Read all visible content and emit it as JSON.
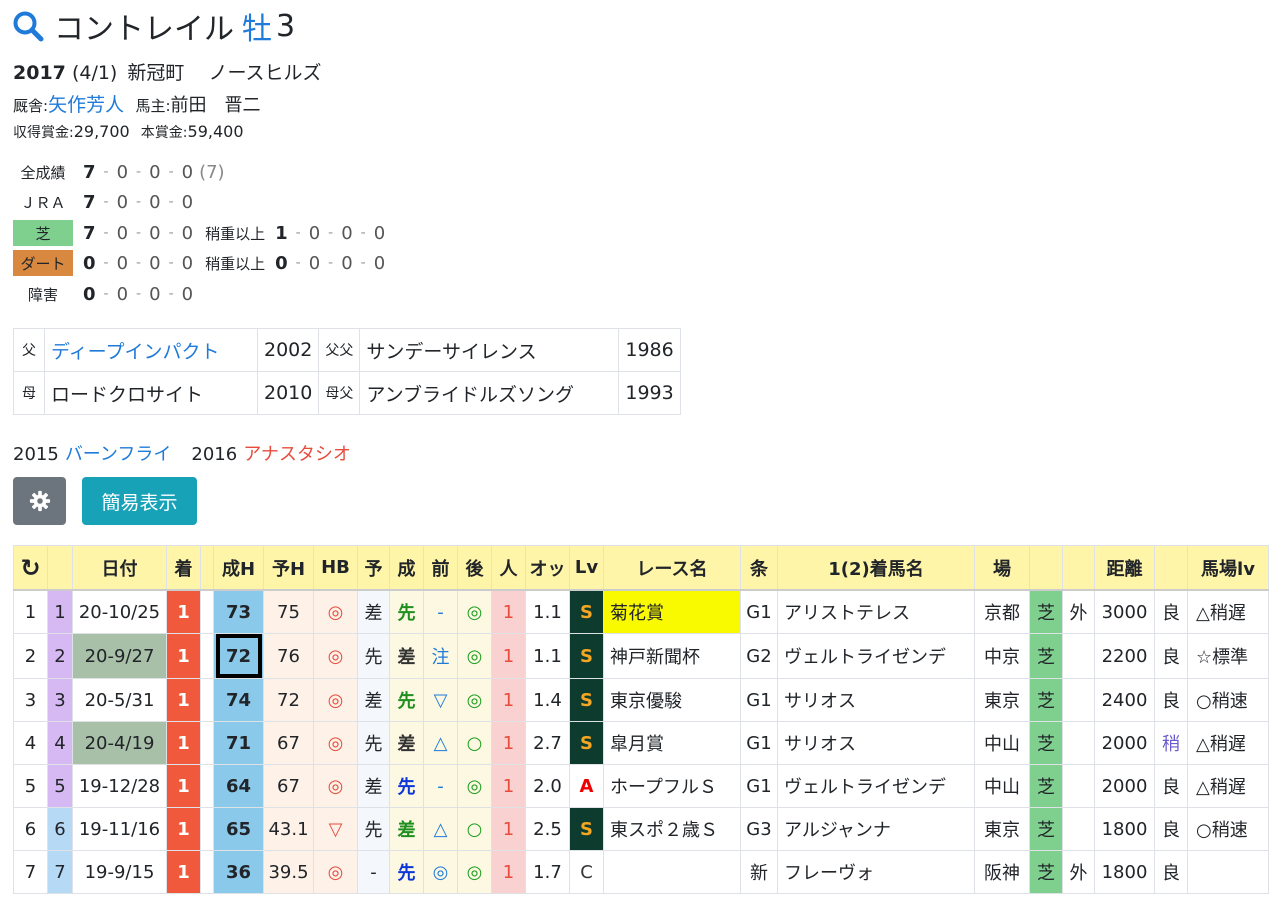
{
  "horse": {
    "name": "コントレイル",
    "sex": "牡",
    "age": "3"
  },
  "info": {
    "birth_year": "2017",
    "birth_date": "(4/1)",
    "place": "新冠町",
    "breeder": "ノースヒルズ",
    "trainer_label": "厩舎:",
    "trainer": "矢作芳人",
    "owner_label": "馬主:",
    "owner": "前田　晋二",
    "earned_label": "収得賞金:",
    "earned": "29,700",
    "prize_label": "本賞金:",
    "prize": "59,400"
  },
  "records": [
    {
      "label": "全成績",
      "values": [
        "7",
        "0",
        "0",
        "0"
      ],
      "extra": "(7)"
    },
    {
      "label": "ＪＲＡ",
      "values": [
        "7",
        "0",
        "0",
        "0"
      ]
    },
    {
      "label": "芝",
      "values": [
        "7",
        "0",
        "0",
        "0"
      ],
      "sub_label": "稍重以上",
      "sub_values": [
        "1",
        "0",
        "0",
        "0"
      ]
    },
    {
      "label": "ダート",
      "values": [
        "0",
        "0",
        "0",
        "0"
      ],
      "sub_label": "稍重以上",
      "sub_values": [
        "0",
        "0",
        "0",
        "0"
      ]
    },
    {
      "label": "障害",
      "values": [
        "0",
        "0",
        "0",
        "0"
      ]
    }
  ],
  "pedigree": [
    {
      "rel1": "父",
      "name1": "ディープインパクト",
      "year1": "2002",
      "rel2": "父父",
      "name2": "サンデーサイレンス",
      "year2": "1986"
    },
    {
      "rel1": "母",
      "name1": "ロードクロサイト",
      "year1": "2010",
      "rel2": "母父",
      "name2": "アンブライドルズソング",
      "year2": "1993"
    }
  ],
  "siblings": [
    {
      "year": "2015",
      "name": "バーンフライ",
      "color": "#1f7ad9"
    },
    {
      "year": "2016",
      "name": "アナスタシオ",
      "color": "#e74c3c"
    }
  ],
  "buttons": {
    "simple": "簡易表示",
    "gear_icon": "gear-icon"
  },
  "table": {
    "headers": [
      "↻",
      "",
      "日付",
      "着",
      "",
      "成H",
      "予H",
      "HB",
      "予",
      "成",
      "前",
      "後",
      "人",
      "オッ",
      "Lv",
      "レース名",
      "条",
      "1(2)着馬名",
      "場",
      "",
      "",
      "距離",
      "",
      "馬場lv"
    ],
    "rows": [
      {
        "no": "1",
        "no2": "1",
        "date": "20-10/25",
        "fin": "1",
        "rat": "73",
        "pre": "75",
        "hb": "◎",
        "yo": "差",
        "sei": "先",
        "mae": "-",
        "ato": "◎",
        "pop": "1",
        "odds": "1.1",
        "lv": "S",
        "race": "菊花賞",
        "cls": "G1",
        "winner": "アリストテレス",
        "place": "京都",
        "surf": "芝",
        "io": "外",
        "dist": "3000",
        "cond": "良",
        "baba": "△稍遅"
      },
      {
        "no": "2",
        "no2": "2",
        "date": "20-9/27",
        "fin": "1",
        "rat": "72",
        "pre": "76",
        "hb": "◎",
        "yo": "先",
        "sei": "差",
        "mae": "注",
        "ato": "◎",
        "pop": "1",
        "odds": "1.1",
        "lv": "S",
        "race": "神戸新聞杯",
        "cls": "G2",
        "winner": "ヴェルトライゼンデ",
        "place": "中京",
        "surf": "芝",
        "io": "",
        "dist": "2200",
        "cond": "良",
        "baba": "☆標準"
      },
      {
        "no": "3",
        "no2": "3",
        "date": "20-5/31",
        "fin": "1",
        "rat": "74",
        "pre": "72",
        "hb": "◎",
        "yo": "差",
        "sei": "先",
        "mae": "▽",
        "ato": "◎",
        "pop": "1",
        "odds": "1.4",
        "lv": "S",
        "race": "東京優駿",
        "cls": "G1",
        "winner": "サリオス",
        "place": "東京",
        "surf": "芝",
        "io": "",
        "dist": "2400",
        "cond": "良",
        "baba": "○稍速"
      },
      {
        "no": "4",
        "no2": "4",
        "date": "20-4/19",
        "fin": "1",
        "rat": "71",
        "pre": "67",
        "hb": "◎",
        "yo": "先",
        "sei": "差",
        "mae": "△",
        "ato": "○",
        "pop": "1",
        "odds": "2.7",
        "lv": "S",
        "race": "皐月賞",
        "cls": "G1",
        "winner": "サリオス",
        "place": "中山",
        "surf": "芝",
        "io": "",
        "dist": "2000",
        "cond": "稍",
        "baba": "△稍遅"
      },
      {
        "no": "5",
        "no2": "5",
        "date": "19-12/28",
        "fin": "1",
        "rat": "64",
        "pre": "67",
        "hb": "◎",
        "yo": "差",
        "sei": "先",
        "mae": "-",
        "ato": "◎",
        "pop": "1",
        "odds": "2.0",
        "lv": "A",
        "race": "ホープフルＳ",
        "cls": "G1",
        "winner": "ヴェルトライゼンデ",
        "place": "中山",
        "surf": "芝",
        "io": "",
        "dist": "2000",
        "cond": "良",
        "baba": "△稍遅"
      },
      {
        "no": "6",
        "no2": "6",
        "date": "19-11/16",
        "fin": "1",
        "rat": "65",
        "pre": "43.1",
        "hb": "▽",
        "yo": "先",
        "sei": "差",
        "mae": "△",
        "ato": "○",
        "pop": "1",
        "odds": "2.5",
        "lv": "S",
        "race": "東スポ２歳Ｓ",
        "cls": "G3",
        "winner": "アルジャンナ",
        "place": "東京",
        "surf": "芝",
        "io": "",
        "dist": "1800",
        "cond": "良",
        "baba": "○稍速"
      },
      {
        "no": "7",
        "no2": "7",
        "date": "19-9/15",
        "fin": "1",
        "rat": "36",
        "pre": "39.5",
        "hb": "◎",
        "yo": "-",
        "sei": "先",
        "mae": "◎",
        "ato": "◎",
        "pop": "1",
        "odds": "1.7",
        "lv": "C",
        "race": "",
        "cls": "新",
        "winner": "フレーヴォ",
        "place": "阪神",
        "surf": "芝",
        "io": "外",
        "dist": "1800",
        "cond": "良",
        "baba": ""
      }
    ]
  }
}
